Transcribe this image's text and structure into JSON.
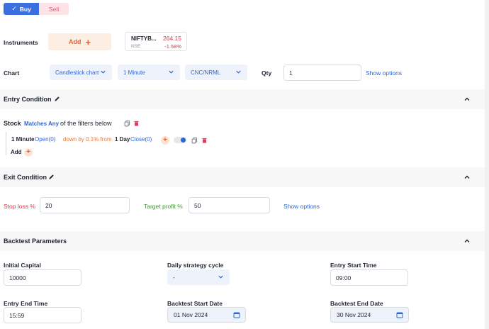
{
  "order_side": {
    "buy_label": "Buy",
    "sell_label": "Sell"
  },
  "instruments": {
    "label": "Instruments",
    "add_label": "Add",
    "card": {
      "symbol": "NIFTYB...",
      "exchange": "NSE",
      "price": "264.15",
      "change": "-1.58%"
    }
  },
  "chart_row": {
    "label": "Chart",
    "chart_type": "Candlestick chart",
    "interval": "1 Minute",
    "product": "CNC/NRML",
    "qty_label": "Qty",
    "qty_value": "1",
    "show_options": "Show options"
  },
  "entry_condition": {
    "title": "Entry Condition",
    "stock_label": "Stock",
    "match_mode": "Matches Any",
    "filters_suffix": "of the filters below",
    "filter": {
      "timeframe": "1 Minute",
      "field": "Open(0)",
      "operator": "down by 0.1% from",
      "compare_timeframe": "1 Day",
      "compare_field": "Close(0)"
    },
    "add_label": "Add"
  },
  "exit_condition": {
    "title": "Exit Condition",
    "stop_loss_label": "Stop loss %",
    "stop_loss_value": "20",
    "target_label": "Target profit %",
    "target_value": "50",
    "show_options": "Show options"
  },
  "backtest": {
    "title": "Backtest Parameters",
    "initial_capital_label": "Initial Capital",
    "initial_capital_value": "10000",
    "cycle_label": "Daily strategy cycle",
    "cycle_value": "-",
    "entry_start_label": "Entry Start Time",
    "entry_start_value": "09:00",
    "entry_end_label": "Entry End Time",
    "entry_end_value": "15:59",
    "start_date_label": "Backtest Start Date",
    "start_date_value": "01 Nov 2024",
    "end_date_label": "Backtest End Date",
    "end_date_value": "30 Nov 2024"
  },
  "colors": {
    "accent": "#2f64d8",
    "buy": "#3b6fe0",
    "sell": "#e45a73",
    "orange": "#e8622a",
    "stop_loss": "#d83a4f",
    "target": "#3a9a2a",
    "delete": "#e0365a"
  }
}
